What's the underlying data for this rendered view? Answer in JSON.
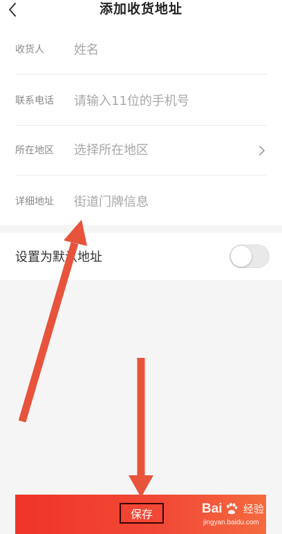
{
  "header": {
    "title": "添加收货地址",
    "back_icon": "chevron-left-icon"
  },
  "form": {
    "name": {
      "label": "收货人",
      "placeholder": "姓名",
      "value": ""
    },
    "phone": {
      "label": "联系电话",
      "placeholder": "请输入11位的手机号",
      "value": ""
    },
    "region": {
      "label": "所在地区",
      "value": "选择所在地区",
      "icon": "chevron-right-icon"
    },
    "address": {
      "label": "详细地址",
      "placeholder": "街道门牌信息",
      "value": ""
    }
  },
  "default_address": {
    "label": "设置为默认地址",
    "enabled": false
  },
  "footer": {
    "save_label": "保存"
  },
  "watermark": {
    "brand": "Bai",
    "brand_cn": "经验",
    "url": "jingyan.baidu.com"
  },
  "colors": {
    "accent": "#f0342a",
    "annotation_arrow": "#e8533c"
  }
}
